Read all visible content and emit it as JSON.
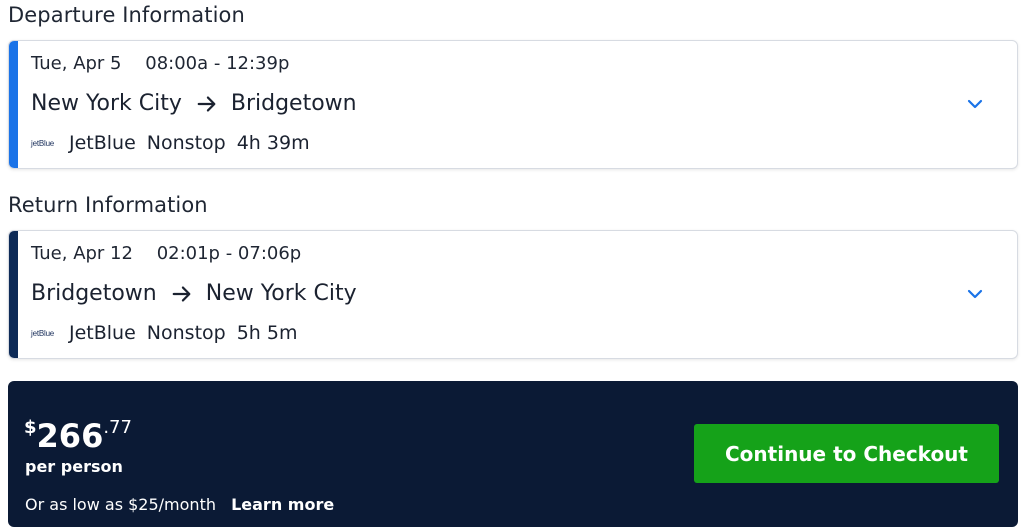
{
  "departure": {
    "heading": "Departure Information",
    "date": "Tue, Apr 5",
    "time": "08:00a - 12:39p",
    "origin": "New York City",
    "destination": "Bridgetown",
    "airline_logo_text": "jetBlue",
    "airline": "JetBlue",
    "stops": "Nonstop",
    "duration": "4h 39m"
  },
  "return": {
    "heading": "Return Information",
    "date": "Tue, Apr 12",
    "time": "02:01p - 07:06p",
    "origin": "Bridgetown",
    "destination": "New York City",
    "airline_logo_text": "jetBlue",
    "airline": "JetBlue",
    "stops": "Nonstop",
    "duration": "5h 5m"
  },
  "pricing": {
    "currency": "$",
    "whole": "266",
    "cents": ".77",
    "unit": "per person",
    "financing": "Or as low as $25/month",
    "learn_more": "Learn more",
    "checkout_label": "Continue to Checkout"
  },
  "colors": {
    "departure_accent": "#1a73e8",
    "return_accent": "#0d2a57",
    "panel_bg": "#0b1a35",
    "checkout_green": "#15a219",
    "chevron_blue": "#1a73e8"
  },
  "icons": {
    "route_arrow": "arrow-right-icon",
    "expand": "chevron-down-icon"
  }
}
